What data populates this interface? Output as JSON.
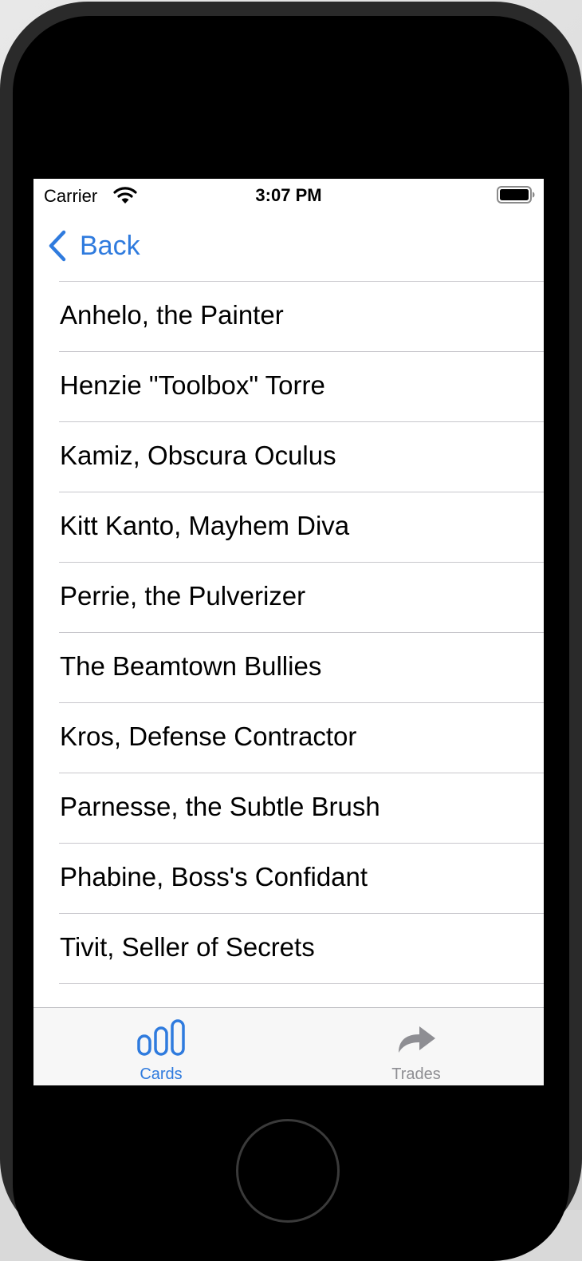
{
  "status_bar": {
    "carrier": "Carrier",
    "time": "3:07 PM",
    "wifi_icon": "wifi-icon",
    "battery_icon": "battery-full-icon"
  },
  "nav": {
    "back_label": "Back",
    "back_icon": "chevron-left-icon"
  },
  "cards": [
    "Anhelo, the Painter",
    "Henzie \"Toolbox\" Torre",
    "Kamiz, Obscura Oculus",
    "Kitt Kanto, Mayhem Diva",
    "Perrie, the Pulverizer",
    "The Beamtown Bullies",
    "Kros, Defense Contractor",
    "Parnesse, the Subtle Brush",
    "Phabine, Boss's Confidant",
    "Tivit, Seller of Secrets"
  ],
  "tab_bar": {
    "selected": "Cards",
    "tabs": [
      {
        "label": "Cards",
        "icon": "bar-chart-icon"
      },
      {
        "label": "Trades",
        "icon": "share-arrow-icon"
      }
    ]
  },
  "colors": {
    "accent": "#2f7bde",
    "inactive_tab": "#8e8e93",
    "separator": "#c8c7cc",
    "tab_bar_bg": "#f7f7f7"
  }
}
